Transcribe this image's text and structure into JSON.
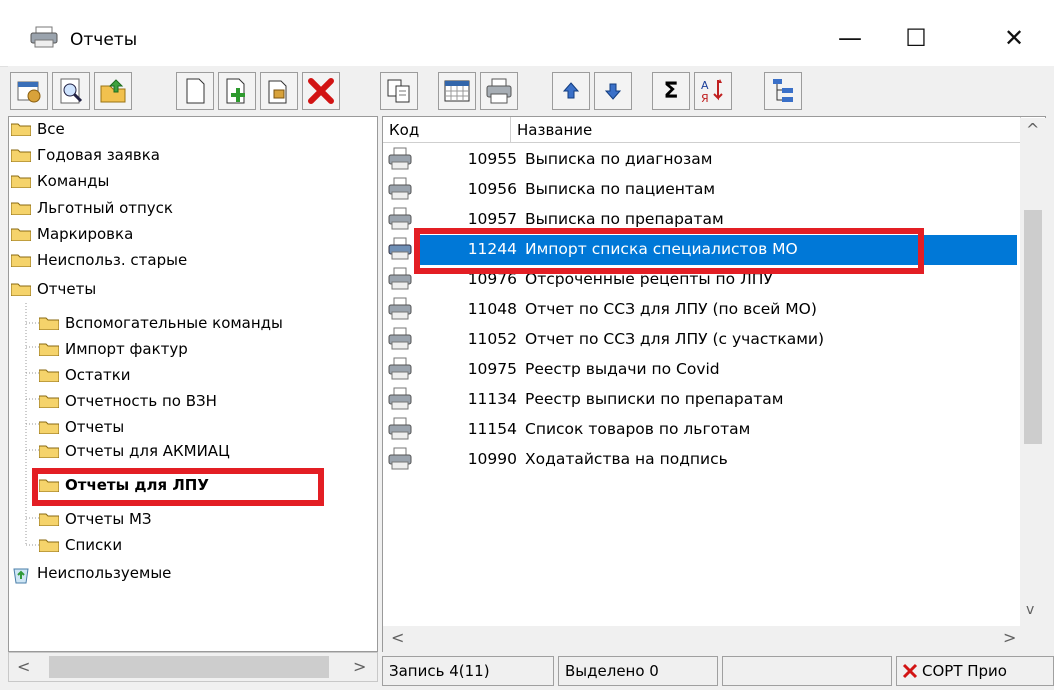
{
  "window": {
    "title": "Отчеты",
    "minimize": "—",
    "maximize": "☐",
    "close": "✕"
  },
  "toolbar": {
    "sum": "Σ"
  },
  "tree": {
    "items": [
      {
        "label": "Все"
      },
      {
        "label": "Годовая заявка"
      },
      {
        "label": "Команды"
      },
      {
        "label": "Льготный отпуск"
      },
      {
        "label": "Маркировка"
      },
      {
        "label": "Неиспольз. старые"
      },
      {
        "label": "Отчеты"
      },
      {
        "label": "Вспомогательные команды"
      },
      {
        "label": "Импорт фактур"
      },
      {
        "label": "Остатки"
      },
      {
        "label": "Отчетность по ВЗН"
      },
      {
        "label": "Отчеты"
      },
      {
        "label": "Отчеты для АКМИАЦ"
      },
      {
        "label": "Отчеты для ЛПУ"
      },
      {
        "label": "Отчеты МЗ"
      },
      {
        "label": "Списки"
      },
      {
        "label": "Неиспользуемые"
      }
    ]
  },
  "list": {
    "columns": {
      "code": "Код",
      "name": "Название"
    },
    "rows": [
      {
        "code": "10955",
        "name": "Выписка по диагнозам"
      },
      {
        "code": "10956",
        "name": "Выписка по пациентам"
      },
      {
        "code": "10957",
        "name": "Выписка по препаратам"
      },
      {
        "code": "11244",
        "name": "Импорт списка специалистов МО"
      },
      {
        "code": "10976",
        "name": "Отсроченные рецепты по ЛПУ"
      },
      {
        "code": "11048",
        "name": "Отчет по ССЗ для ЛПУ (по всей МО)"
      },
      {
        "code": "11052",
        "name": "Отчет по ССЗ для ЛПУ (с участками)"
      },
      {
        "code": "10975",
        "name": "Реестр выдачи по Covid"
      },
      {
        "code": "11134",
        "name": "Реестр выписки по препаратам"
      },
      {
        "code": "11154",
        "name": "Список товаров по льготам"
      },
      {
        "code": "10990",
        "name": "Ходатайства на подпись"
      }
    ]
  },
  "status": {
    "record": "Запись 4(11)",
    "selected": "Выделено 0",
    "sort": "СОРТ Прио"
  },
  "colors": {
    "selection": "#0078d7",
    "highlight": "#e31e24",
    "folder": "#f5d36b"
  }
}
